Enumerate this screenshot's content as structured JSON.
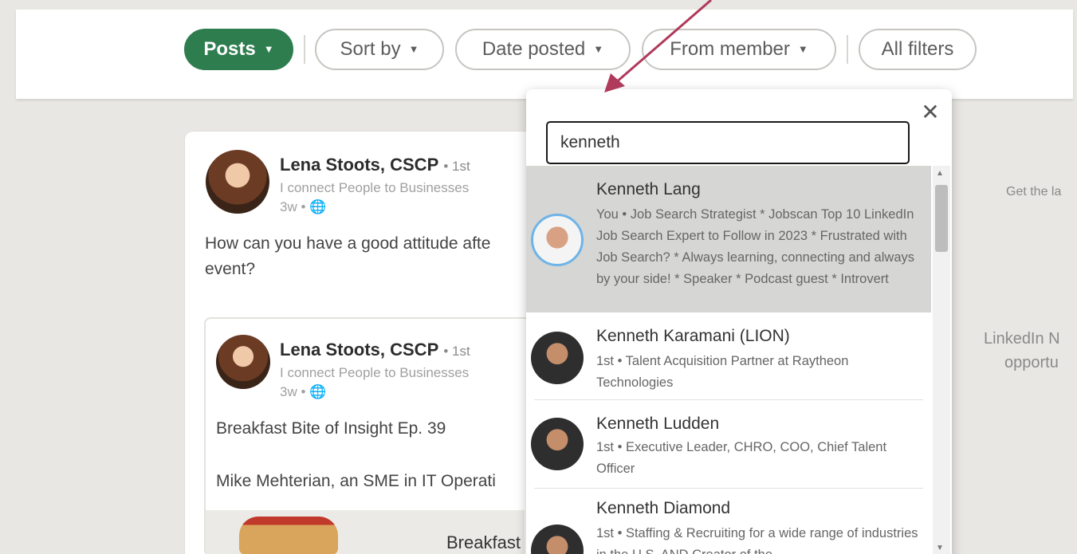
{
  "filters": {
    "posts": "Posts",
    "sort_by": "Sort by",
    "date_posted": "Date posted",
    "from_member": "From member",
    "all_filters": "All filters"
  },
  "colors": {
    "active_pill": "#2e7d4f",
    "annotation_arrow": "#b03a5b",
    "highlight_row": "#d6d6d4"
  },
  "post1": {
    "author": "Lena Stoots, CSCP",
    "degree": "• 1st",
    "headline": "I connect People to Businesses",
    "time": "3w •",
    "text_line1": "How can you have a good attitude afte",
    "text_line2": "event?"
  },
  "post2": {
    "author": "Lena Stoots, CSCP",
    "degree": "• 1st",
    "headline": "I connect People to Businesses",
    "time": "3w •",
    "text_line1": "Breakfast Bite of Insight Ep. 39",
    "text_line2": "Mike Mehterian, an SME in IT Operati",
    "thumb_title": "Breakfast"
  },
  "right_side": {
    "top": "Get the la",
    "line1": "LinkedIn N",
    "line2": "opportu"
  },
  "member_search": {
    "value": "kenneth",
    "close": "✕",
    "results": [
      {
        "name": "Kenneth Lang",
        "desc": "You • Job Search Strategist * Jobscan Top 10 LinkedIn Job Search Expert to Follow in 2023 * Frustrated with Job Search? * Always learning, connecting and always by your side! * Speaker * Podcast guest * Introvert"
      },
      {
        "name": "Kenneth Karamani (LION)",
        "desc": "1st • Talent Acquisition Partner at Raytheon Technologies"
      },
      {
        "name": "Kenneth Ludden",
        "desc": "1st • Executive Leader, CHRO, COO, Chief Talent Officer"
      },
      {
        "name": "Kenneth Diamond",
        "desc": "1st • Staffing & Recruiting for a wide range of industries in the U.S. AND Creator of the"
      }
    ]
  }
}
